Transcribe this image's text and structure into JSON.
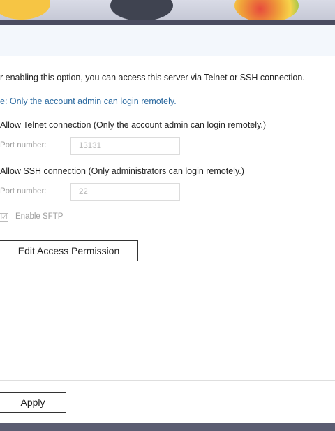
{
  "settings": {
    "intro_text": "r enabling this option, you can access this server via Telnet or SSH connection.",
    "note_text": "e: Only the account admin can login remotely.",
    "telnet": {
      "label": "Allow Telnet connection (Only the account admin can login remotely.)",
      "port_label": "Port number:",
      "port_value": "13131"
    },
    "ssh": {
      "label": "Allow SSH connection (Only administrators can login remotely.)",
      "port_label": "Port number:",
      "port_value": "22"
    },
    "sftp": {
      "label": "Enable SFTP",
      "checked": true,
      "check_glyph": "☑"
    },
    "edit_access_button": "Edit Access Permission"
  },
  "footer": {
    "apply_button": "Apply"
  },
  "colors": {
    "note_text": "#2c6aa0",
    "disabled_text": "#a0a0a0",
    "header_bg": "#f3f7fc"
  },
  "icons": {
    "sftp_checkbox": "checkbox-checked-icon"
  }
}
